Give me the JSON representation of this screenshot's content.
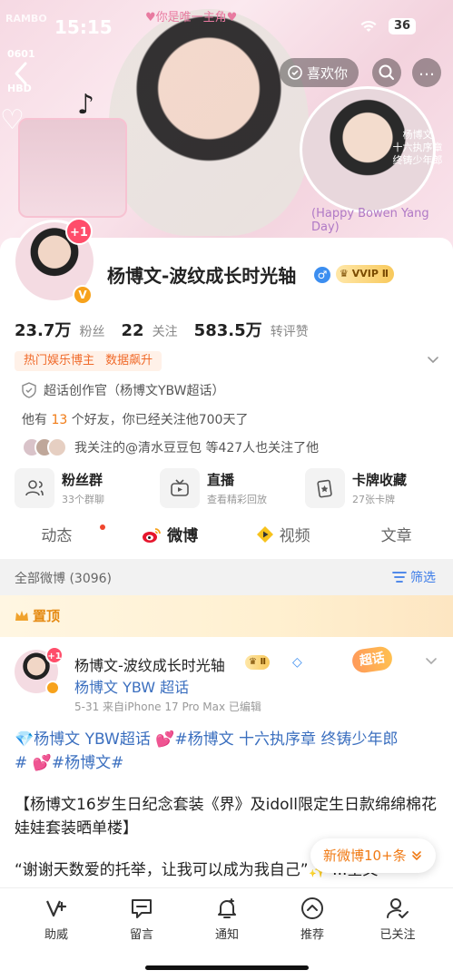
{
  "status_bar": {
    "time": "15:15",
    "battery": "36"
  },
  "banner": {
    "top_tag": "♥你是唯一主角♥",
    "corner_text": "RAMBO",
    "hbd_line1": "0601",
    "hbd_line2": "HBD",
    "caption_line1": "杨博文",
    "caption_line2": "十六执序章",
    "caption_line3": "终铸少年郎",
    "happy_text": "(Happy Bowen Yang Day)",
    "note_glyph": "♪",
    "heart_glyph": "♡",
    "like_button": "喜欢你",
    "more_glyph": "…"
  },
  "profile": {
    "avatar_badge": "+1",
    "avatar_v": "V",
    "name": "杨博文-波纹成长时光轴",
    "gender_glyph": "♂",
    "vip_label": "VVIP Ⅱ",
    "stats": [
      {
        "value": "23.7万",
        "label": "粉丝"
      },
      {
        "value": "22",
        "label": "关注"
      },
      {
        "value": "583.5万",
        "label": "转评赞"
      }
    ],
    "tags": [
      "热门娱乐博主",
      "数据飙升"
    ],
    "cert": "超话创作官（杨博文YBW超话）",
    "friends_prefix": "他有 ",
    "friends_count": "13",
    "friends_suffix": " 个好友，你已经关注他700天了",
    "mutual_text": "我关注的@清水豆豆包  等427人也关注了他"
  },
  "cards": [
    {
      "title": "粉丝群",
      "sub": "33个群聊",
      "icon": "group-icon"
    },
    {
      "title": "直播",
      "sub": "查看精彩回放",
      "icon": "tv-icon"
    },
    {
      "title": "卡牌收藏",
      "sub": "27张卡牌",
      "icon": "card-icon"
    }
  ],
  "tabs": [
    {
      "label": "动态",
      "active": false
    },
    {
      "label": "微博",
      "active": true
    },
    {
      "label": "视频",
      "active": false
    },
    {
      "label": "文章",
      "active": false
    }
  ],
  "filter": {
    "all_label": "全部微博 (3096)",
    "filter_label": "筛选"
  },
  "pinned": {
    "label": "置顶"
  },
  "post": {
    "avatar_badge": "+1",
    "author": "杨博文-波纹成长时光轴",
    "vip": "Ⅱ",
    "topic": "杨博文 YBW 超话",
    "meta": "5-31  来自iPhone 17 Pro Max  已编辑",
    "chaohua_tag": "超话",
    "line1_a": "💎杨博文 YBW超话",
    "line1_b": " 💕",
    "line1_c": "#杨博文 十六执序章 终铸少年郎",
    "line1_d": "#",
    "line1_e": " 💕",
    "line1_f": "#杨博文#",
    "para2": "【杨博文16岁生日纪念套装《界》及idoll限定生日款绵绵棉花娃娃套装晒单楼】",
    "para3": "“谢谢天数爱的托举，让我可以成为我自己”✨ ...全文"
  },
  "new_posts": "新微博10+条",
  "bottom_nav": [
    {
      "label": "助威",
      "icon": "cheer-icon"
    },
    {
      "label": "留言",
      "icon": "message-icon"
    },
    {
      "label": "通知",
      "icon": "bell-icon"
    },
    {
      "label": "推荐",
      "icon": "recommend-icon"
    },
    {
      "label": "已关注",
      "icon": "followed-icon"
    }
  ],
  "colors": {
    "accent": "#F07A14",
    "link": "#3B6FBF",
    "vip_gold": "#F8C95C",
    "badge_red": "#FF4D6A"
  }
}
